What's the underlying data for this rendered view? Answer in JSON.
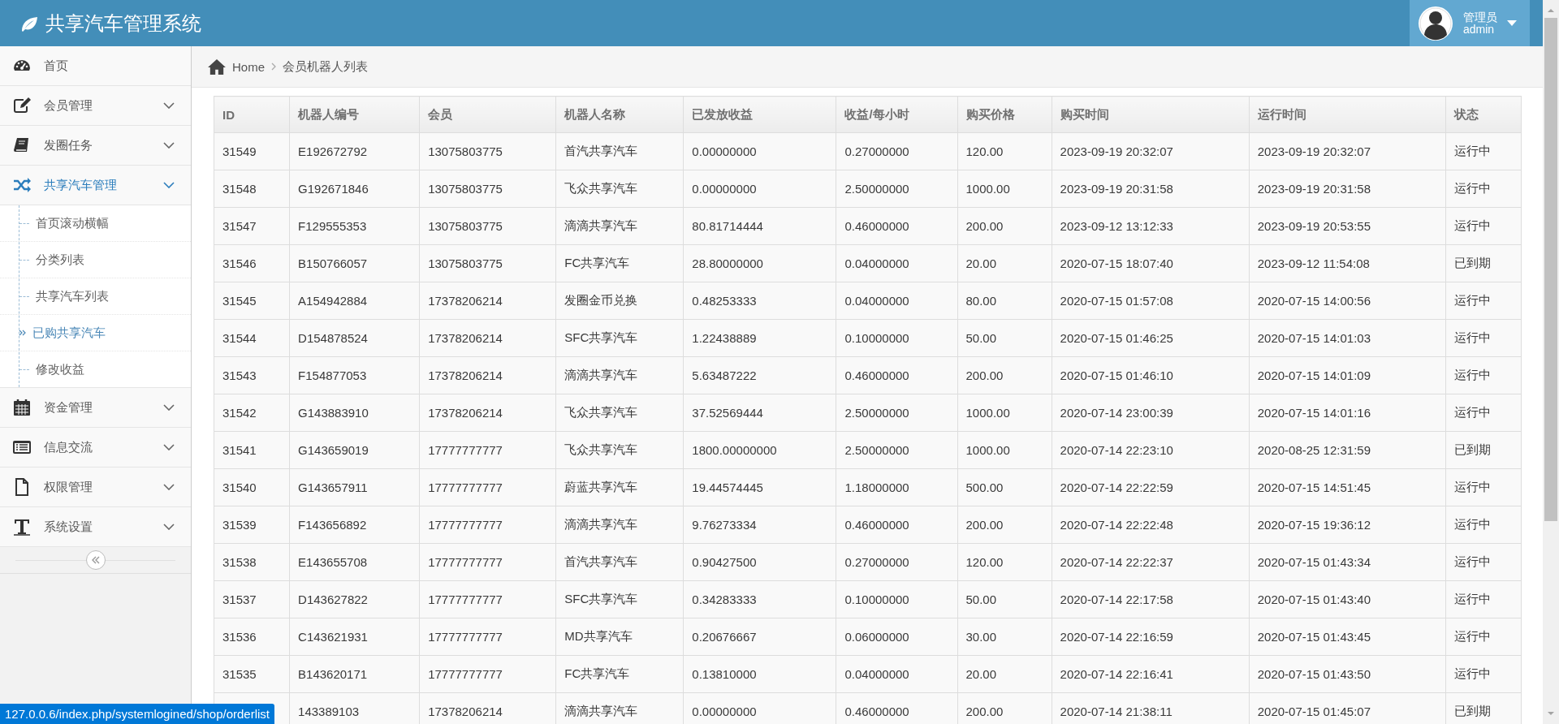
{
  "header": {
    "title": "共享汽车管理系统",
    "user": {
      "role": "管理员",
      "name": "admin"
    }
  },
  "sidebar": {
    "items": [
      {
        "label": "首页",
        "kind": "link",
        "selected": false
      },
      {
        "label": "会员管理",
        "kind": "menu",
        "selected": false,
        "expanded": false
      },
      {
        "label": "发圈任务",
        "kind": "menu",
        "selected": false,
        "expanded": false
      },
      {
        "label": "共享汽车管理",
        "kind": "menu",
        "selected": true,
        "expanded": true,
        "children": [
          {
            "label": "首页滚动横幅",
            "selected": false
          },
          {
            "label": "分类列表",
            "selected": false
          },
          {
            "label": "共享汽车列表",
            "selected": false
          },
          {
            "label": "已购共享汽车",
            "selected": true
          },
          {
            "label": "修改收益",
            "selected": false
          }
        ]
      },
      {
        "label": "资金管理",
        "kind": "menu",
        "selected": false,
        "expanded": false
      },
      {
        "label": "信息交流",
        "kind": "menu",
        "selected": false,
        "expanded": false
      },
      {
        "label": "权限管理",
        "kind": "menu",
        "selected": false,
        "expanded": false
      },
      {
        "label": "系统设置",
        "kind": "menu",
        "selected": false,
        "expanded": false
      }
    ]
  },
  "breadcrumb": [
    "Home",
    "会员机器人列表"
  ],
  "table": {
    "columns": [
      "ID",
      "机器人编号",
      "会员",
      "机器人名称",
      "已发放收益",
      "收益/每小时",
      "购买价格",
      "购买时间",
      "运行时间",
      "状态"
    ],
    "rows": [
      [
        "31549",
        "E192672792",
        "13075803775",
        "首汽共享汽车",
        "0.00000000",
        "0.27000000",
        "120.00",
        "2023-09-19 20:32:07",
        "2023-09-19 20:32:07",
        "运行中"
      ],
      [
        "31548",
        "G192671846",
        "13075803775",
        "飞众共享汽车",
        "0.00000000",
        "2.50000000",
        "1000.00",
        "2023-09-19 20:31:58",
        "2023-09-19 20:31:58",
        "运行中"
      ],
      [
        "31547",
        "F129555353",
        "13075803775",
        "滴滴共享汽车",
        "80.81714444",
        "0.46000000",
        "200.00",
        "2023-09-12 13:12:33",
        "2023-09-19 20:53:55",
        "运行中"
      ],
      [
        "31546",
        "B150766057",
        "13075803775",
        "FC共享汽车",
        "28.80000000",
        "0.04000000",
        "20.00",
        "2020-07-15 18:07:40",
        "2023-09-12 11:54:08",
        "已到期"
      ],
      [
        "31545",
        "A154942884",
        "17378206214",
        "发圈金币兑换",
        "0.48253333",
        "0.04000000",
        "80.00",
        "2020-07-15 01:57:08",
        "2020-07-15 14:00:56",
        "运行中"
      ],
      [
        "31544",
        "D154878524",
        "17378206214",
        "SFC共享汽车",
        "1.22438889",
        "0.10000000",
        "50.00",
        "2020-07-15 01:46:25",
        "2020-07-15 14:01:03",
        "运行中"
      ],
      [
        "31543",
        "F154877053",
        "17378206214",
        "滴滴共享汽车",
        "5.63487222",
        "0.46000000",
        "200.00",
        "2020-07-15 01:46:10",
        "2020-07-15 14:01:09",
        "运行中"
      ],
      [
        "31542",
        "G143883910",
        "17378206214",
        "飞众共享汽车",
        "37.52569444",
        "2.50000000",
        "1000.00",
        "2020-07-14 23:00:39",
        "2020-07-15 14:01:16",
        "运行中"
      ],
      [
        "31541",
        "G143659019",
        "17777777777",
        "飞众共享汽车",
        "1800.00000000",
        "2.50000000",
        "1000.00",
        "2020-07-14 22:23:10",
        "2020-08-25 12:31:59",
        "已到期"
      ],
      [
        "31540",
        "G143657911",
        "17777777777",
        "蔚蓝共享汽车",
        "19.44574445",
        "1.18000000",
        "500.00",
        "2020-07-14 22:22:59",
        "2020-07-15 14:51:45",
        "运行中"
      ],
      [
        "31539",
        "F143656892",
        "17777777777",
        "滴滴共享汽车",
        "9.76273334",
        "0.46000000",
        "200.00",
        "2020-07-14 22:22:48",
        "2020-07-15 19:36:12",
        "运行中"
      ],
      [
        "31538",
        "E143655708",
        "17777777777",
        "首汽共享汽车",
        "0.90427500",
        "0.27000000",
        "120.00",
        "2020-07-14 22:22:37",
        "2020-07-15 01:43:34",
        "运行中"
      ],
      [
        "31537",
        "D143627822",
        "17777777777",
        "SFC共享汽车",
        "0.34283333",
        "0.10000000",
        "50.00",
        "2020-07-14 22:17:58",
        "2020-07-15 01:43:40",
        "运行中"
      ],
      [
        "31536",
        "C143621931",
        "17777777777",
        "MD共享汽车",
        "0.20676667",
        "0.06000000",
        "30.00",
        "2020-07-14 22:16:59",
        "2020-07-15 01:43:45",
        "运行中"
      ],
      [
        "31535",
        "B143620171",
        "17777777777",
        "FC共享汽车",
        "0.13810000",
        "0.04000000",
        "20.00",
        "2020-07-14 22:16:41",
        "2020-07-15 01:43:50",
        "运行中"
      ],
      [
        null,
        "143389103",
        "17378206214",
        "滴滴共享汽车",
        "0.00000000",
        "0.46000000",
        "200.00",
        "2020-07-14 21:38:11",
        "2020-07-15 01:45:07",
        "已到期"
      ]
    ]
  },
  "status_bar": {
    "url": "127.0.0.6/index.php/systemlogined/shop/orderlist"
  }
}
